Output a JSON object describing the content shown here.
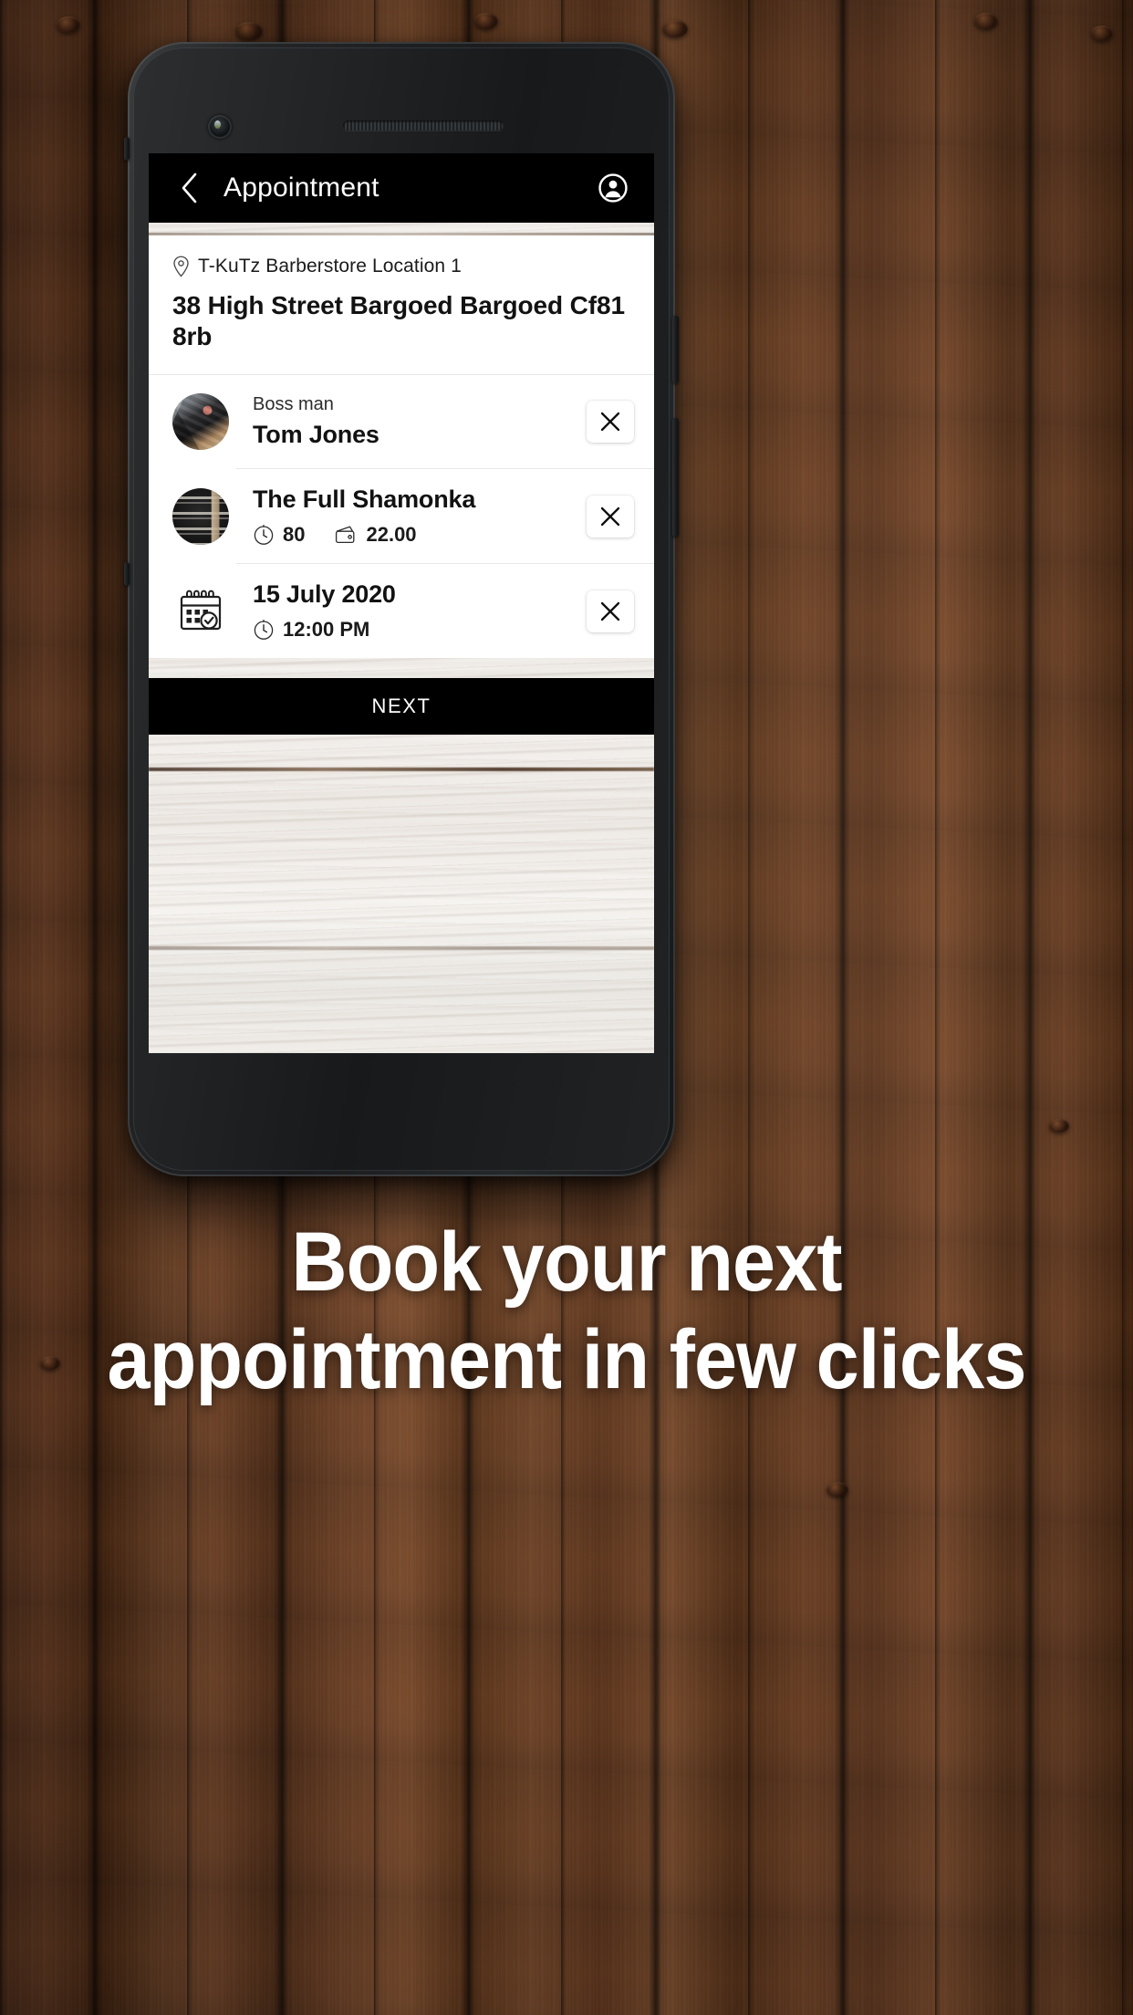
{
  "app": {
    "header": {
      "title": "Appointment",
      "back_icon": "chevron-left-icon",
      "profile_icon": "account-circle-icon"
    },
    "location": {
      "pin_icon": "location-pin-icon",
      "name": "T-KuTz Barberstore Location 1",
      "address": "38 High Street Bargoed Bargoed Cf81 8rb"
    },
    "rows": [
      {
        "type": "barber",
        "thumb_icon": "barber-photo-thumb",
        "eyebrow": "Boss man",
        "title": "Tom Jones",
        "remove_icon": "close-icon"
      },
      {
        "type": "service",
        "thumb_icon": "service-poster-thumb",
        "title": "The Full Shamonka",
        "duration_icon": "clock-icon",
        "duration": "80",
        "price_icon": "wallet-icon",
        "price": "22.00",
        "remove_icon": "close-icon"
      },
      {
        "type": "datetime",
        "thumb_icon": "calendar-check-icon",
        "title": "15 July 2020",
        "time_icon": "clock-icon",
        "time": "12:00 PM",
        "remove_icon": "close-icon"
      }
    ],
    "next_button": {
      "label": "NEXT"
    }
  },
  "caption": {
    "line1": "Book your next",
    "line2": "appointment in few clicks"
  },
  "colors": {
    "header_bg": "#000000",
    "card_bg": "#ffffff",
    "next_bg": "#000000",
    "next_text": "#ffffff",
    "text_primary": "#121212",
    "divider": "#e7e7e7",
    "caption_text": "#ffffff",
    "backdrop_wood": "#56321c"
  }
}
